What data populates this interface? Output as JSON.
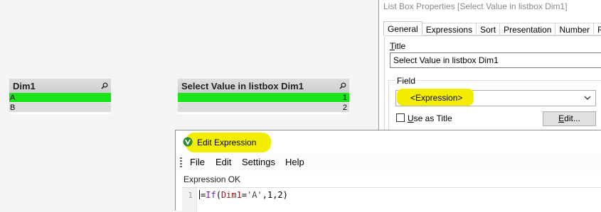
{
  "listbox1": {
    "title": "Dim1",
    "search_icon": "search-icon",
    "rows": [
      {
        "label": "A",
        "state": "selected"
      },
      {
        "label": "B",
        "state": "alternative"
      }
    ]
  },
  "listbox2": {
    "title": "Select Value in listbox Dim1",
    "search_icon": "search-icon",
    "rows": [
      {
        "label": "1",
        "state": "selected"
      },
      {
        "label": "2",
        "state": "alternative"
      }
    ]
  },
  "properties_dialog": {
    "window_title": "List Box Properties [Select Value in listbox Dim1]",
    "tabs": [
      "General",
      "Expressions",
      "Sort",
      "Presentation",
      "Number",
      "Font"
    ],
    "active_tab": "General",
    "title_label_mnemonic": "T",
    "title_label_rest": "itle",
    "title_value": "Select Value in listbox Dim1",
    "field_group_label": "Field",
    "field_value": "<Expression>",
    "use_as_title_mnemonic": "U",
    "use_as_title_rest": "se as Title",
    "use_as_title_checked": false,
    "edit_button_mnemonic": "E",
    "edit_button_rest": "dit..."
  },
  "expression_editor": {
    "window_title": "Edit Expression",
    "app_icon": "qlikview-icon",
    "menu": [
      "File",
      "Edit",
      "Settings",
      "Help"
    ],
    "status": "Expression OK",
    "line_number": "1",
    "code": {
      "prefix": "=",
      "function": "If",
      "open": "(",
      "field": "Dim1",
      "equals": "=",
      "string": "'A'",
      "rest": ",1,2)"
    }
  },
  "colors": {
    "selected": "#19e519",
    "alternative": "#dcdcdc",
    "highlight": "#f3ee00"
  }
}
